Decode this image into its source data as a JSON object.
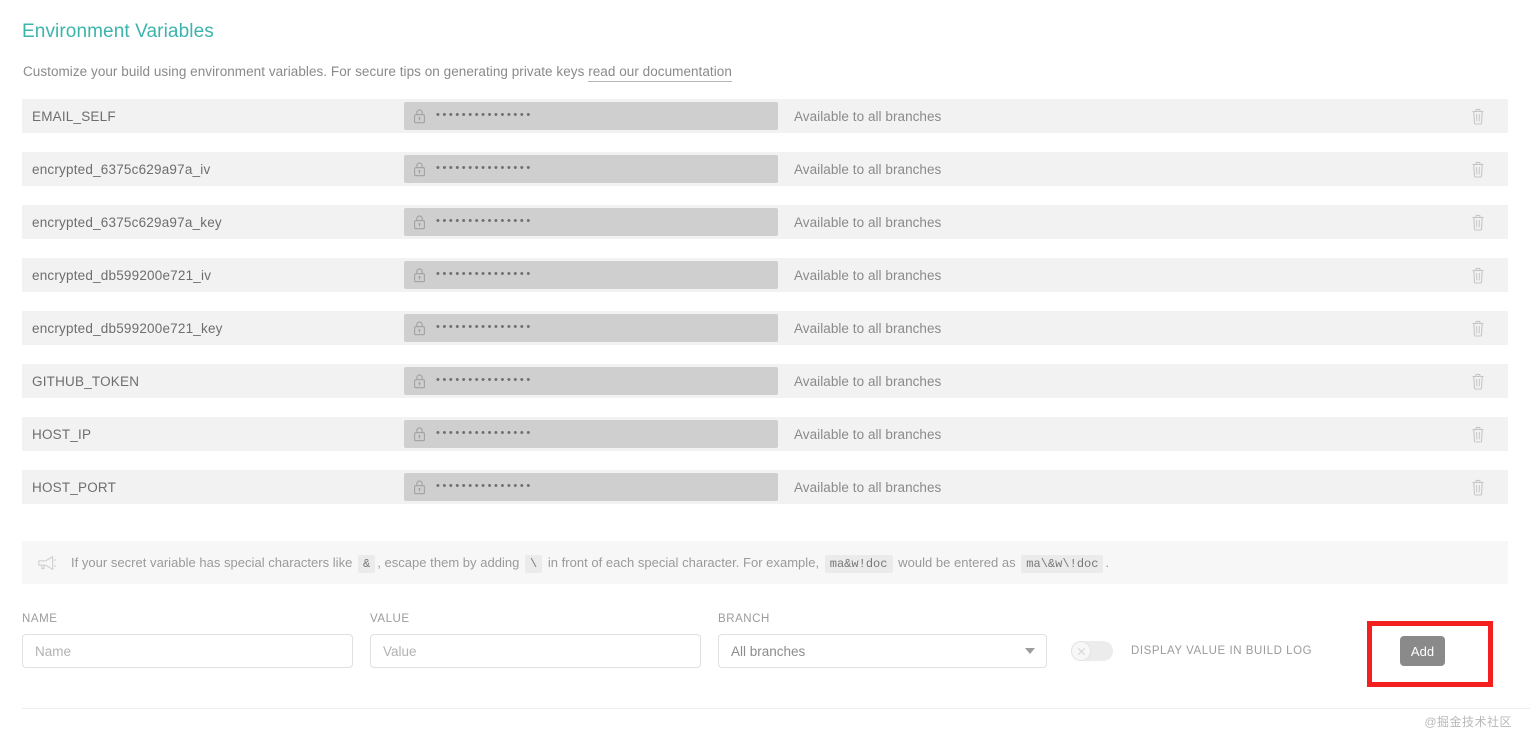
{
  "header": {
    "title": "Environment Variables",
    "subtitle_prefix": "Customize your build using environment variables. For secure tips on generating private keys ",
    "doc_link": "read our documentation"
  },
  "table": {
    "masked_value": "•••••••••••••••",
    "rows": [
      {
        "name": "EMAIL_SELF",
        "value": "•••••••••••••••",
        "branch": "Available to all branches"
      },
      {
        "name": "encrypted_6375c629a97a_iv",
        "value": "•••••••••••••••",
        "branch": "Available to all branches"
      },
      {
        "name": "encrypted_6375c629a97a_key",
        "value": "•••••••••••••••",
        "branch": "Available to all branches"
      },
      {
        "name": "encrypted_db599200e721_iv",
        "value": "•••••••••••••••",
        "branch": "Available to all branches"
      },
      {
        "name": "encrypted_db599200e721_key",
        "value": "•••••••••••••••",
        "branch": "Available to all branches"
      },
      {
        "name": "GITHUB_TOKEN",
        "value": "•••••••••••••••",
        "branch": "Available to all branches"
      },
      {
        "name": "HOST_IP",
        "value": "•••••••••••••••",
        "branch": "Available to all branches"
      },
      {
        "name": "HOST_PORT",
        "value": "•••••••••••••••",
        "branch": "Available to all branches"
      }
    ]
  },
  "hint": {
    "part1": "If your secret variable has special characters like",
    "code1": "&",
    "part2": ", escape them by adding",
    "code2": "\\",
    "part3": "in front of each special character. For example,",
    "code3": "ma&w!doc",
    "part4": "would be entered as",
    "code4": "ma\\&w\\!doc",
    "part5": "."
  },
  "form": {
    "name_label": "NAME",
    "name_placeholder": "Name",
    "name_value": "",
    "value_label": "VALUE",
    "value_placeholder": "Value",
    "value_value": "",
    "branch_label": "BRANCH",
    "branch_selected": "All branches",
    "branch_options": [
      "All branches"
    ],
    "display_toggle_label": "DISPLAY VALUE IN BUILD LOG",
    "display_toggle_state": "off",
    "add_label": "Add"
  },
  "footer": {
    "watermark": "@掘金技术社区"
  },
  "colors": {
    "accent_teal": "#3cb4ac",
    "row_bg": "#f2f2f2",
    "value_bg": "#cfcfcf",
    "highlight_red": "#f42020",
    "add_button_bg": "#8a8a8a"
  }
}
